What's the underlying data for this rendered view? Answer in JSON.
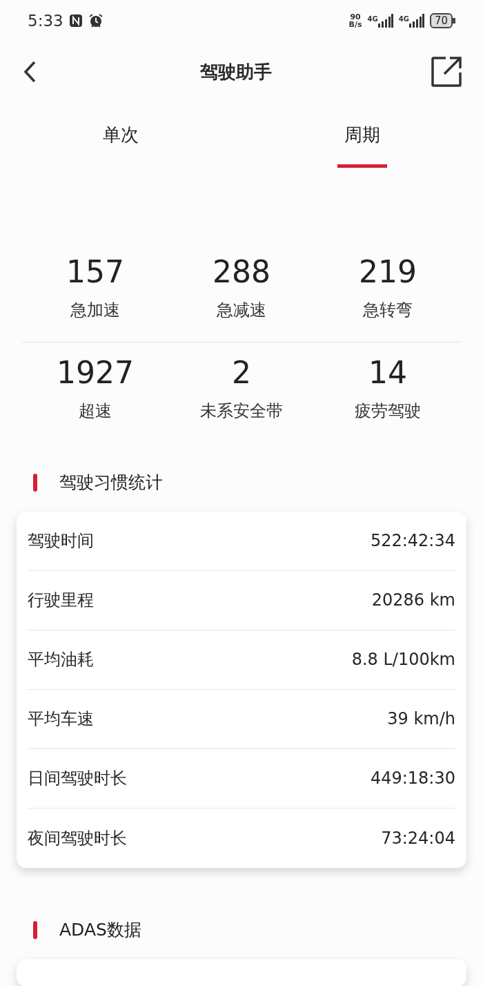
{
  "status_bar": {
    "time": "5:33",
    "net_speed": "90",
    "net_unit": "B/s",
    "signals": [
      "4G",
      "4G"
    ],
    "battery": "70"
  },
  "header": {
    "title": "驾驶助手"
  },
  "tabs": [
    {
      "label": "单次",
      "selected": false
    },
    {
      "label": "周期",
      "selected": true
    }
  ],
  "events": [
    [
      {
        "value": "157",
        "label": "急加速"
      },
      {
        "value": "288",
        "label": "急减速"
      },
      {
        "value": "219",
        "label": "急转弯"
      }
    ],
    [
      {
        "value": "1927",
        "label": "超速"
      },
      {
        "value": "2",
        "label": "未系安全带"
      },
      {
        "value": "14",
        "label": "疲劳驾驶"
      }
    ]
  ],
  "sections": [
    {
      "title": "驾驶习惯统计",
      "rows": [
        {
          "label": "驾驶时间",
          "value": "522:42:34"
        },
        {
          "label": "行驶里程",
          "value": "20286 km"
        },
        {
          "label": "平均油耗",
          "value": "8.8 L/100km"
        },
        {
          "label": "平均车速",
          "value": "39 km/h"
        },
        {
          "label": "日间驾驶时长",
          "value": "449:18:30"
        },
        {
          "label": "夜间驾驶时长",
          "value": "73:24:04"
        }
      ]
    },
    {
      "title": "ADAS数据"
    }
  ]
}
